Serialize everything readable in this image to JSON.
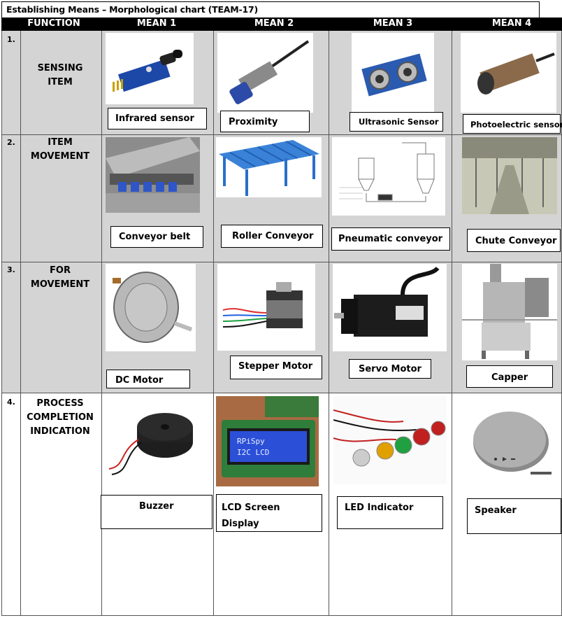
{
  "title": "Establishing Means – Morphological chart   (TEAM-17)",
  "header": {
    "function": "FUNCTION",
    "mean1": "MEAN 1",
    "mean2": "MEAN 2",
    "mean3": "MEAN 3",
    "mean4": "MEAN 4"
  },
  "rows": [
    {
      "num": "1.",
      "function_lines": [
        "SENSING",
        "ITEM"
      ],
      "means": [
        "Infrared sensor",
        "Proximity",
        "Ultrasonic Sensor",
        "Photoelectric sensor"
      ]
    },
    {
      "num": "2.",
      "function_lines": [
        "ITEM",
        "MOVEMENT"
      ],
      "means": [
        "Conveyor belt",
        "Roller Conveyor",
        "Pneumatic conveyor",
        "Chute Conveyor"
      ]
    },
    {
      "num": "3.",
      "function_lines": [
        "FOR",
        "MOVEMENT"
      ],
      "means": [
        "DC Motor",
        "Stepper Motor",
        "Servo Motor",
        "Capper"
      ]
    },
    {
      "num": "4.",
      "function_lines": [
        "PROCESS",
        "COMPLETION",
        "INDICATION"
      ],
      "means": [
        "Buzzer",
        "LCD Screen Display",
        "LED Indicator",
        "Speaker"
      ]
    }
  ],
  "lcd_text": [
    "RPiSpy",
    "I2C LCD"
  ],
  "colors": {
    "header_bg": "#000000",
    "cell_bg": "#d4d4d4"
  }
}
